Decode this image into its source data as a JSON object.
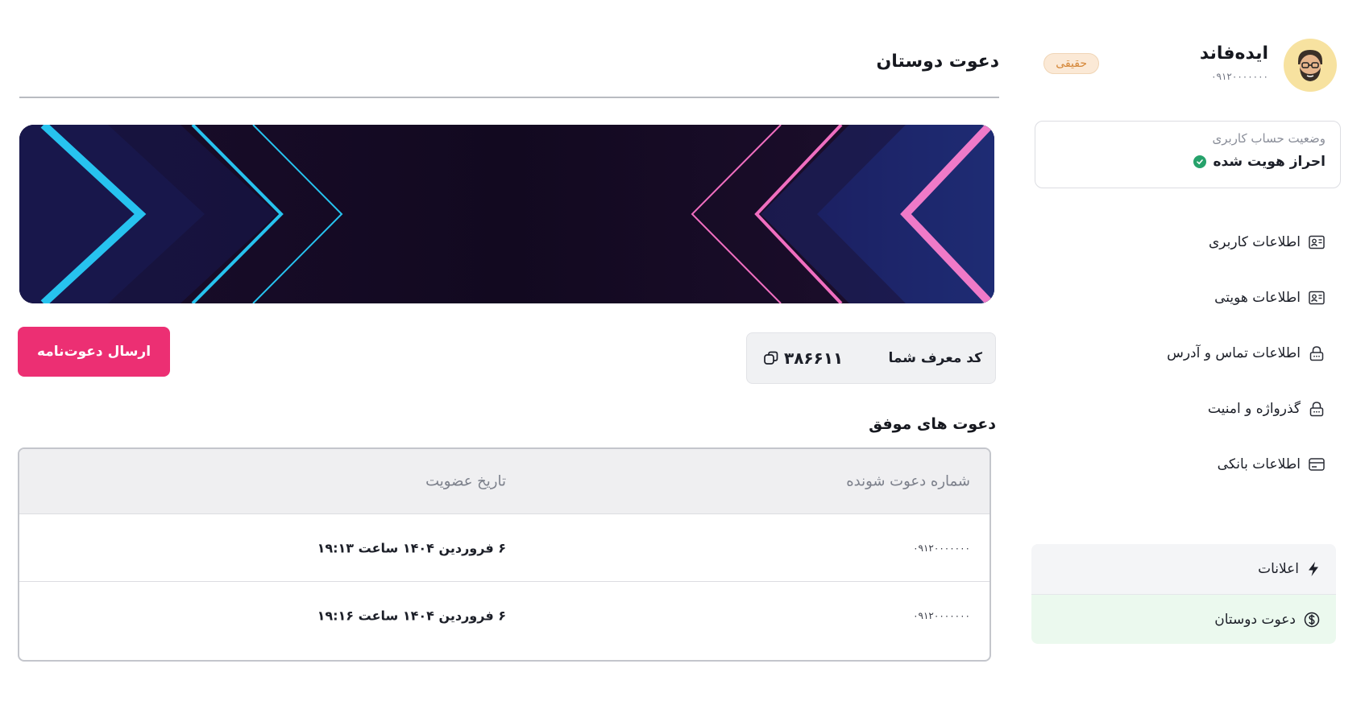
{
  "profile": {
    "name": "ایده‌فاند",
    "phone": "۰۹۱۲۰۰۰۰۰۰۰",
    "type_badge": "حقیقی"
  },
  "account_status": {
    "label": "وضعیت حساب کاربری",
    "value": "احراز هویت شده"
  },
  "sidebar": {
    "items": [
      {
        "label": "اطلاعات کاربری",
        "icon": "id-card-icon"
      },
      {
        "label": "اطلاعات هویتی",
        "icon": "id-card-icon"
      },
      {
        "label": "اطلاعات تماس و آدرس",
        "icon": "lock-icon"
      },
      {
        "label": "گذرواژه و امنیت",
        "icon": "lock-icon"
      },
      {
        "label": "اطلاعات بانکی",
        "icon": "bank-card-icon"
      }
    ],
    "bottom_items": [
      {
        "label": "اعلانات",
        "icon": "lightning-icon"
      },
      {
        "label": "دعوت دوستان",
        "icon": "dollar-circle-icon",
        "active": true
      }
    ]
  },
  "main": {
    "title": "دعوت دوستان",
    "referral": {
      "label": "کد معرف شما",
      "code": "۳۸۶۶۱۱"
    },
    "invite_button": "ارسال دعوت‌نامه",
    "successful_title": "دعوت های موفق",
    "table": {
      "headers": [
        "شماره دعوت شونده",
        "تاریخ عضویت"
      ],
      "rows": [
        [
          "۰۹۱۲۰۰۰۰۰۰۰",
          "۶ فروردین ۱۴۰۴ ساعت ۱۹:۱۳"
        ],
        [
          "۰۹۱۲۰۰۰۰۰۰۰",
          "۶ فروردین ۱۴۰۴ ساعت ۱۹:۱۶"
        ]
      ]
    }
  },
  "colors": {
    "accent_pink": "#ec2f73",
    "success_green": "#26a26b",
    "badge_orange": "#d48535"
  }
}
